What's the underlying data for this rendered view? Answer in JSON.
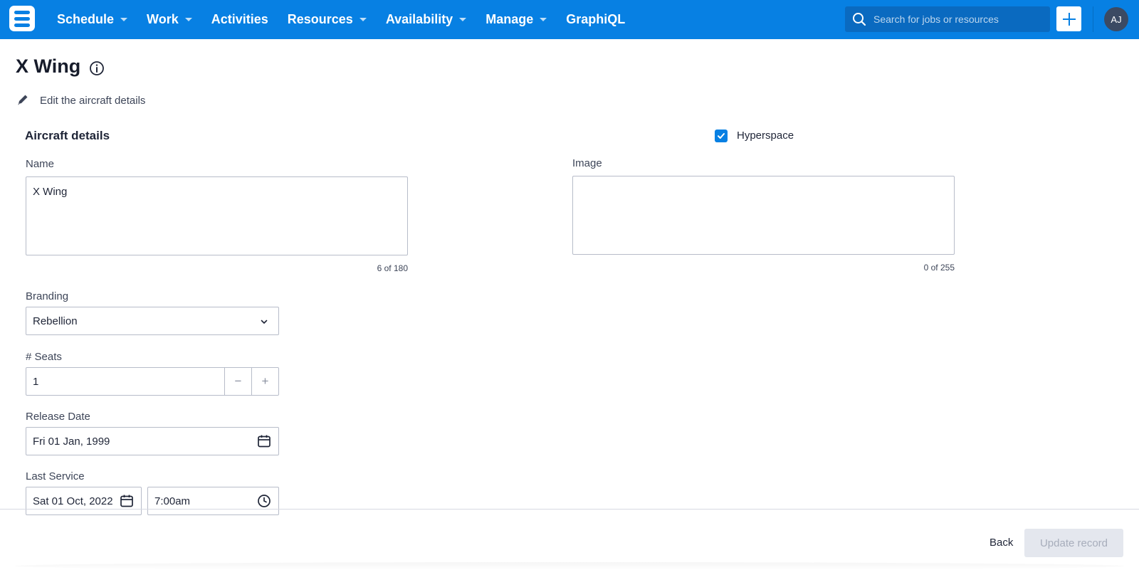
{
  "nav": {
    "items": [
      {
        "label": "Schedule",
        "has_menu": true
      },
      {
        "label": "Work",
        "has_menu": true
      },
      {
        "label": "Activities",
        "has_menu": false
      },
      {
        "label": "Resources",
        "has_menu": true
      },
      {
        "label": "Availability",
        "has_menu": true
      },
      {
        "label": "Manage",
        "has_menu": true
      },
      {
        "label": "GraphiQL",
        "has_menu": false
      }
    ],
    "search_placeholder": "Search for jobs or resources",
    "avatar_initials": "AJ"
  },
  "header": {
    "title": "X Wing",
    "subtitle": "Edit the aircraft details"
  },
  "form": {
    "section_title": "Aircraft details",
    "hyperspace": {
      "label": "Hyperspace",
      "checked": true
    },
    "name": {
      "label": "Name",
      "value": "X Wing",
      "counter": "6 of 180"
    },
    "image": {
      "label": "Image",
      "value": "",
      "counter": "0 of 255"
    },
    "branding": {
      "label": "Branding",
      "value": "Rebellion"
    },
    "seats": {
      "label": "# Seats",
      "value": "1",
      "decrement": "−",
      "increment": "+"
    },
    "release_date": {
      "label": "Release Date",
      "value": "Fri 01 Jan, 1999"
    },
    "last_service": {
      "label": "Last Service",
      "date": "Sat 01 Oct, 2022",
      "time": "7:00am"
    }
  },
  "footer": {
    "back_label": "Back",
    "update_label": "Update record"
  },
  "colors": {
    "nav_bg": "#0780e3",
    "search_bg": "#0a6ac0",
    "avatar_bg": "#3b4a63",
    "checkbox": "#0780e3",
    "disabled_btn_bg": "#e4e7ee"
  }
}
